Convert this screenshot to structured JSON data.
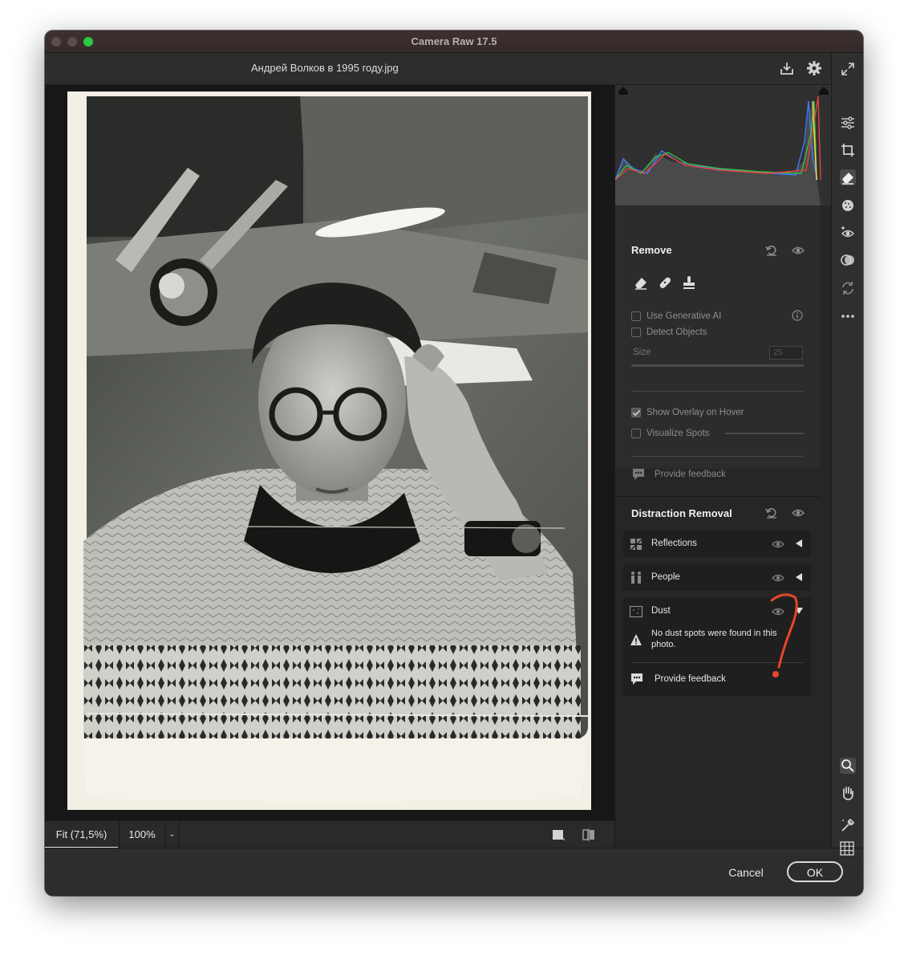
{
  "window": {
    "title": "Camera Raw 17.5"
  },
  "header": {
    "filename": "Андрей Волков в 1995 году.jpg"
  },
  "view": {
    "zoom_fit": "Fit (71,5%)",
    "zoom_100": "100%"
  },
  "footer": {
    "cancel_label": "Cancel",
    "ok_label": "OK"
  },
  "remove": {
    "title": "Remove",
    "use_generative_ai": "Use Generative AI",
    "use_generative_ai_checked": false,
    "detect_objects": "Detect Objects",
    "detect_objects_checked": false,
    "size_label": "Size",
    "size_value": "25",
    "show_overlay": "Show Overlay on Hover",
    "show_overlay_checked": true,
    "visualize_spots": "Visualize Spots",
    "visualize_spots_checked": false,
    "feedback": "Provide feedback"
  },
  "distraction_removal": {
    "title": "Distraction Removal",
    "items": [
      {
        "label": "Reflections",
        "state": "collapsed"
      },
      {
        "label": "People",
        "state": "collapsed"
      },
      {
        "label": "Dust",
        "state": "expanded"
      }
    ],
    "dust_message": "No dust spots were found in this photo.",
    "feedback": "Provide feedback"
  },
  "rail": {
    "icons": [
      "edit-sliders-icon",
      "crop-icon",
      "eraser-icon",
      "mask-icon",
      "red-eye-icon",
      "presets-icon",
      "sync-icon",
      "more-icon",
      "zoom-icon",
      "hand-icon",
      "color-sampler-icon",
      "grid-icon"
    ],
    "active": "eraser-icon"
  },
  "colors": {
    "accent_annotation": "#e8462a",
    "panel_bg": "#262626",
    "ok_border": "#d9d9d9"
  }
}
